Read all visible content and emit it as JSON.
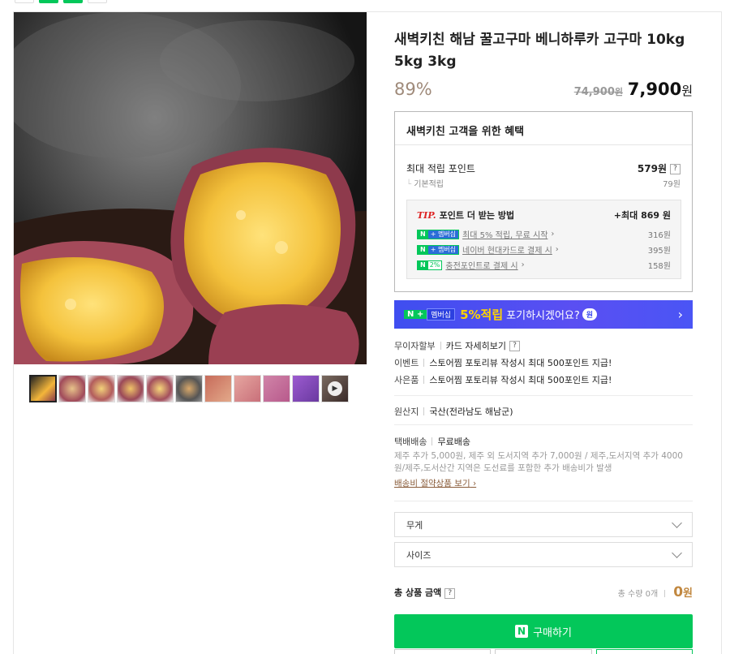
{
  "product": {
    "title": "새벽키친 해남 꿀고구마 베니하루카 고구마 10kg 5kg 3kg",
    "discount": "89%",
    "original_price": "74,900",
    "original_unit": "원",
    "price": "7,900",
    "price_unit": "원"
  },
  "benefit": {
    "heading": "새벽키친 고객을 위한 혜택",
    "max_points_label": "최대 적립 포인트",
    "max_points_value": "579원",
    "basic_label": "기본적립",
    "basic_value": "79원",
    "tip_word": "TIP.",
    "tip_label": "포인트 더 받는 방법",
    "tip_max": "+최대 869 원",
    "tip_items": [
      {
        "badge_n": "N",
        "badge_plus": "+ 멤버십",
        "text": "최대 5% 적립, 무료 시작",
        "value": "316원"
      },
      {
        "badge_n": "N",
        "badge_plus": "+ 멤버십",
        "text": "네이버 현대카드로 결제 시",
        "value": "395원"
      },
      {
        "badge_n": "N",
        "badge_pct": "2%",
        "text": "충전포인트로 결제 시",
        "value": "158원"
      }
    ]
  },
  "banner": {
    "badge_n": "N +",
    "badge_member": "멤버십",
    "highlight": "5%적립",
    "text": "포기하시겠어요?",
    "pill": "원"
  },
  "info_lines": {
    "installment": "무이자할부",
    "card_detail": "카드 자세히보기",
    "event_label": "이벤트",
    "event_text": "스토어찜 포토리뷰 작성시 최대 500포인트 지급!",
    "gift_label": "사은품",
    "gift_text": "스토어찜 포토리뷰 작성시 최대 500포인트 지급!",
    "origin_label": "원산지",
    "origin_text": "국산(전라남도 해남군)",
    "ship_label": "택배배송",
    "ship_text": "무료배송",
    "ship_desc": "제주 추가 5,000원, 제주 외 도서지역 추가 7,000원 / 제주,도서지역 추가 4000원/제주,도서산간 지역은 도선료를 포함한 추가 배송비가 발생",
    "ship_link": "배송비 절약상품 보기"
  },
  "options": [
    {
      "label": "무게"
    },
    {
      "label": "사이즈"
    }
  ],
  "total": {
    "label": "총 상품 금액",
    "qty_text": "총 수량 0개",
    "amount": "0",
    "amount_unit": "원"
  },
  "buy_button": {
    "badge": "N",
    "label": "구매하기"
  },
  "colors": {
    "naver_green": "#03c75a",
    "banner_blue": "#3f4ef0",
    "discount": "#9f8a7a"
  }
}
